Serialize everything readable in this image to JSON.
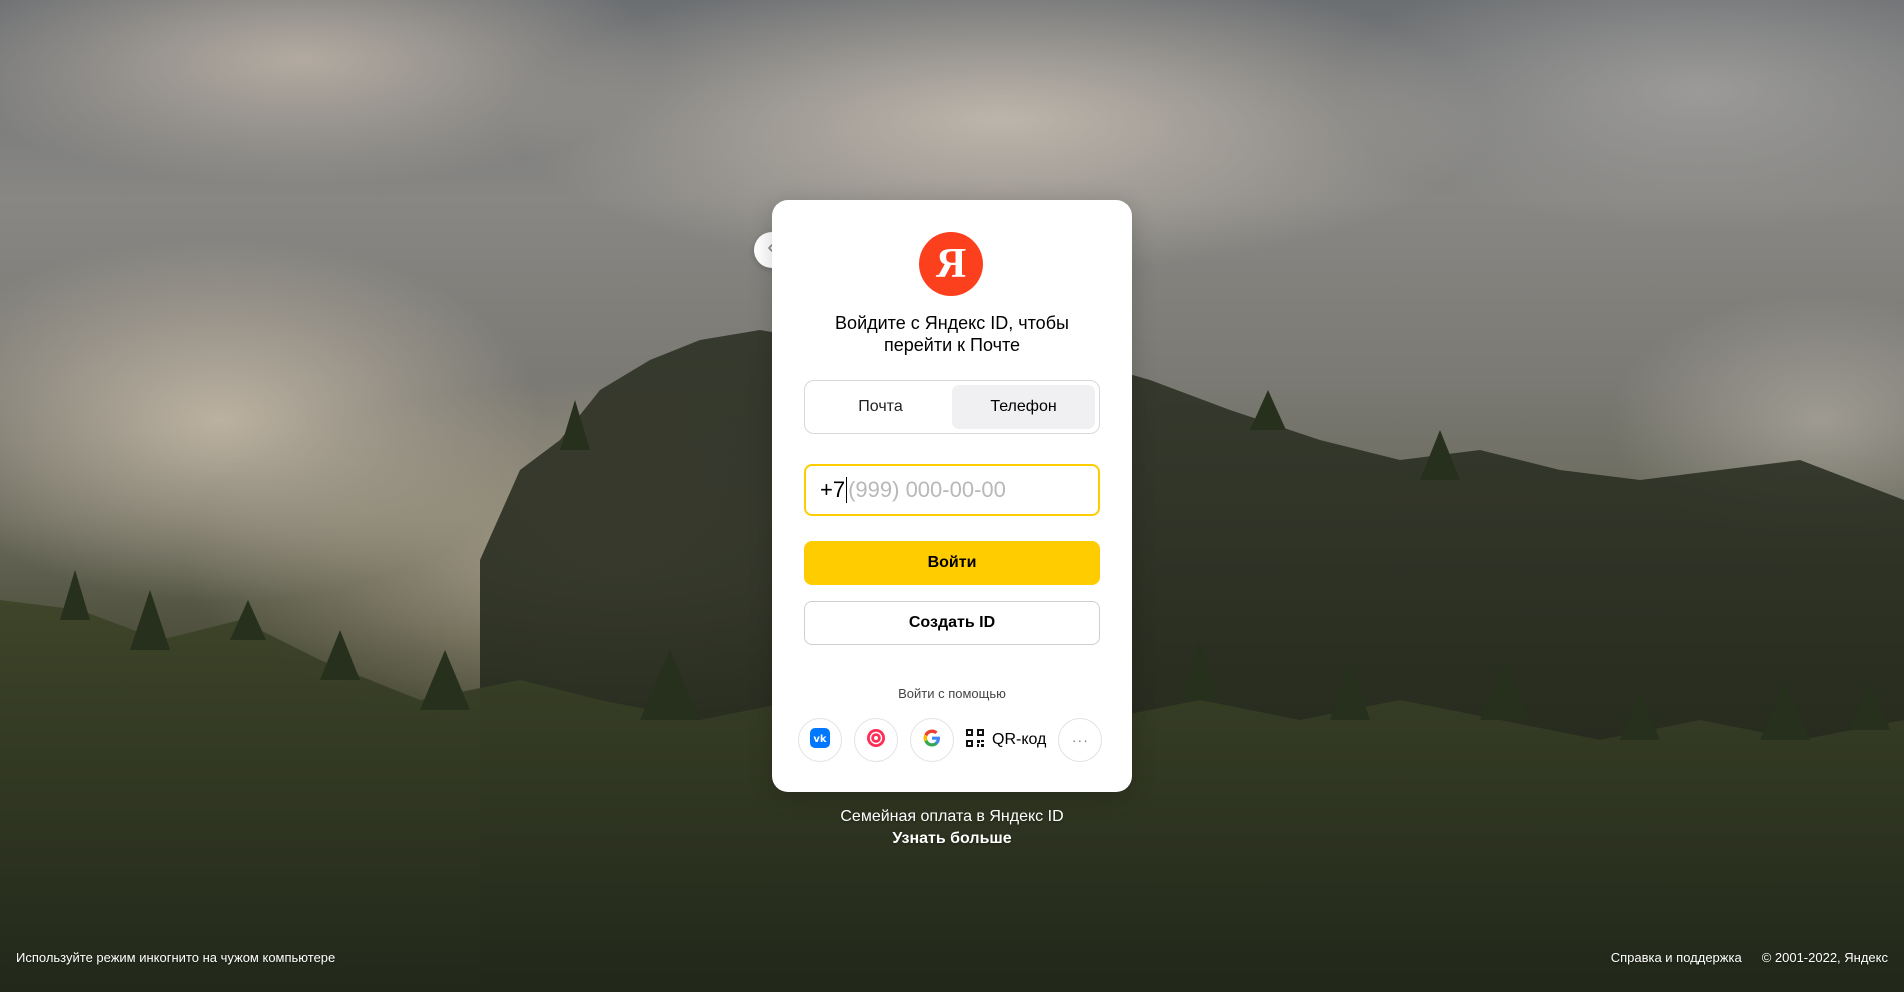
{
  "logo": {
    "letter": "Я"
  },
  "title": "Войдите с Яндекс ID, чтобы перейти к Почте",
  "tabs": [
    {
      "label": "Почта",
      "active": false
    },
    {
      "label": "Телефон",
      "active": true
    }
  ],
  "phone": {
    "prefix": "+7",
    "placeholder": "(999) 000-00-00"
  },
  "buttons": {
    "login": "Войти",
    "create": "Создать ID"
  },
  "social": {
    "label": "Войти с помощью",
    "qr_label": "QR-код",
    "more": "···"
  },
  "promo": {
    "text": "Семейная оплата в Яндекс ID",
    "link": "Узнать больше"
  },
  "footer": {
    "incognito": "Используйте режим инкогнито на чужом компьютере",
    "help": "Справка и поддержка",
    "copyright": "© 2001-2022, Яндекс"
  },
  "colors": {
    "accent": "#ffcc00",
    "brand": "#fc3f1d",
    "vk": "#0077ff"
  },
  "icons": [
    "back-arrow-icon",
    "vk-icon",
    "sber-icon",
    "google-icon",
    "qr-code-icon",
    "more-dots-icon"
  ]
}
